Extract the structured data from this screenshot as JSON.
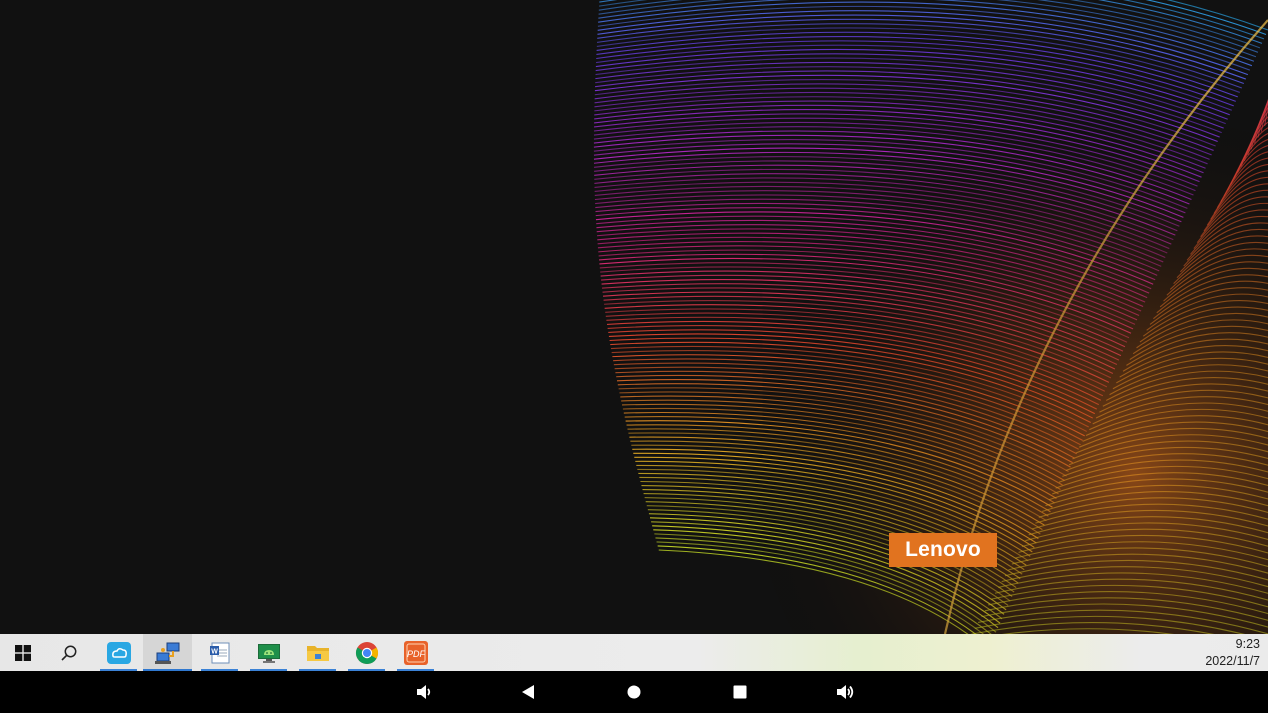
{
  "desktop": {
    "wallpaper_brand": "Lenovo"
  },
  "taskbar": {
    "start_icon": "windows-start-icon",
    "search_icon": "search-icon",
    "apps": [
      {
        "name": "cloud-app",
        "icon": "cloud-icon",
        "state": "running"
      },
      {
        "name": "remote-desktop",
        "icon": "network-computers-icon",
        "state": "active"
      },
      {
        "name": "word",
        "icon": "word-document-icon",
        "state": "running"
      },
      {
        "name": "android-app",
        "icon": "android-icon",
        "state": "running"
      },
      {
        "name": "file-explorer",
        "icon": "folder-icon",
        "state": "running"
      },
      {
        "name": "chrome",
        "icon": "chrome-icon",
        "state": "running"
      },
      {
        "name": "pdf-reader",
        "icon": "pdf-icon",
        "state": "running"
      }
    ],
    "clock": {
      "time": "9:23",
      "date": "2022/11/7"
    }
  },
  "navbar": {
    "buttons": [
      "volume-down-icon",
      "back-icon",
      "home-icon",
      "recents-icon",
      "volume-up-icon"
    ]
  },
  "colors": {
    "brand_orange": "#e1731f",
    "taskbar_bg": "#e9e9e9",
    "running_indicator": "#3b82d6"
  }
}
